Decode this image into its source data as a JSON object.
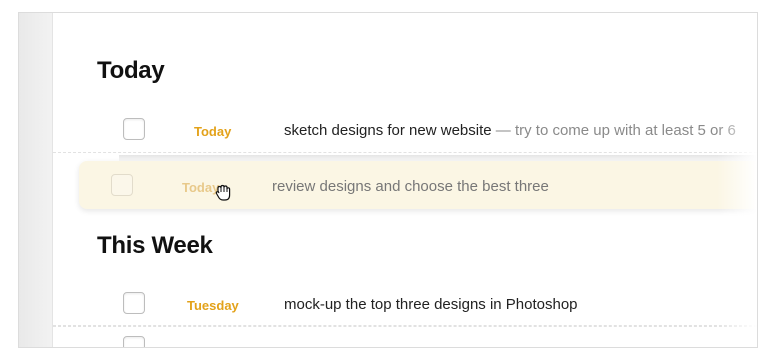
{
  "sections": [
    {
      "title": "Today",
      "tasks": [
        {
          "due": "Today",
          "text": "sketch designs for new website",
          "note": " — try to come up with at least 5 or 6"
        }
      ]
    },
    {
      "title": "This Week",
      "tasks": [
        {
          "due": "Tuesday",
          "text": "mock-up the top three designs in Photoshop"
        }
      ]
    }
  ],
  "dragging_task": {
    "due": "Today",
    "text": "review designs and choose the best three"
  },
  "colors": {
    "due_accent": "#e3a21a",
    "drag_background": "#fbf6e4"
  },
  "icons": {
    "cursor": "grab-hand-cursor-icon"
  }
}
